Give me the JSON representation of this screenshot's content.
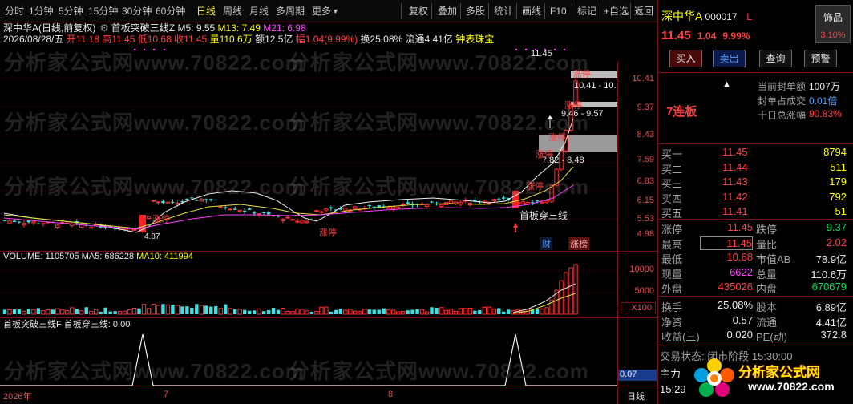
{
  "toolbar": {
    "periods": [
      "分时",
      "1分钟",
      "5分钟",
      "15分钟",
      "30分钟",
      "60分钟",
      "日线",
      "周线",
      "月线",
      "多周期",
      "更多"
    ],
    "active": "日线",
    "tools": [
      "复权",
      "叠加",
      "多股",
      "统计",
      "画线",
      "F10",
      "标记",
      "+自选",
      "返回"
    ],
    "chevron_label": "▼"
  },
  "chart": {
    "stock_header": "深中华A(日线,前复权)",
    "indicator_name": "首板突破三线Z",
    "ma5": "M5: 9.55",
    "ma13": "M13: 7.49",
    "ma21": "M21: 6.98",
    "date_line": "2026/08/28/五",
    "open": "开11.18",
    "high": "高11.45",
    "low": "低10.68",
    "close": "收11.45",
    "volume": "量110.6万",
    "amount": "额12.5亿",
    "change": "幅1.04(9.99%)",
    "turnover": "换25.08%",
    "float": "流通4.41亿",
    "zhongbiao": "钟表珠宝",
    "price_axis": [
      "11.45",
      "10.41",
      "9.37",
      "8.43",
      "7.59",
      "6.83",
      "6.15",
      "5.53",
      "4.98"
    ],
    "annotations": {
      "top_price": "11.45",
      "range1": "10.41 - 10.",
      "range2": "9.46 - 9.57",
      "range3": "7.82 - 8.48",
      "low_price": "4.87",
      "signal": "首板穿三线",
      "zt": "涨停",
      "cai": "财",
      "ztbang": "涨榜"
    },
    "volume_header": {
      "label": "VOLUME: 1105705",
      "ma5": "MA5: 686228",
      "ma10": "MA10: 411994"
    },
    "volume_axis": [
      "10000",
      "5000",
      "X100"
    ],
    "indicator_header": {
      "label": "首板突破三线F",
      "value": "首板穿三线: 0.00"
    },
    "indicator_value": "0.07",
    "x_axis": [
      "2026年",
      "7",
      "8"
    ],
    "period_tag": "日线"
  },
  "quote": {
    "name": "深中华A",
    "code": "000017",
    "flag": "L",
    "sector": "饰品",
    "sector_pct": "3.10%",
    "price": "11.45",
    "change": "1.04",
    "pct": "9.99%",
    "buttons": [
      "买入",
      "卖出",
      "查询",
      "预警"
    ],
    "lianban": "7连板",
    "seal_rows": [
      {
        "label": "当前封单额",
        "value": "1007万"
      },
      {
        "label": "封单占成交",
        "value": "0.01倍"
      },
      {
        "label": "十日总涨幅",
        "value": "90.83%"
      }
    ],
    "bids": [
      {
        "label": "买一",
        "price": "11.45",
        "vol": "8794"
      },
      {
        "label": "买二",
        "price": "11.44",
        "vol": "511"
      },
      {
        "label": "买三",
        "price": "11.43",
        "vol": "179"
      },
      {
        "label": "买四",
        "price": "11.42",
        "vol": "792"
      },
      {
        "label": "买五",
        "price": "11.41",
        "vol": "51"
      }
    ],
    "stats": [
      {
        "l1": "涨停",
        "v1": "11.45",
        "l2": "跌停",
        "v2": "9.37"
      },
      {
        "l1": "最高",
        "v1": "11.45",
        "l2": "量比",
        "v2": "2.02"
      },
      {
        "l1": "最低",
        "v1": "10.68",
        "l2": "市值AB",
        "v2": "78.9亿"
      },
      {
        "l1": "现量",
        "v1": "6622",
        "l2": "总量",
        "v2": "110.6万"
      },
      {
        "l1": "外盘",
        "v1": "435026",
        "l2": "内盘",
        "v2": "670679"
      }
    ],
    "fin": [
      {
        "l1": "换手",
        "v1": "25.08%",
        "l2": "股本",
        "v2": "6.89亿"
      },
      {
        "l1": "净资",
        "v1": "0.57",
        "l2": "流通",
        "v2": "4.41亿"
      },
      {
        "l1": "收益(三)",
        "v1": "0.020",
        "l2": "PE(动)",
        "v2": "372.8"
      }
    ],
    "trade_status": "交易状态: 闭市阶段 15:30:00",
    "zhuli": "主力",
    "time": "15:29"
  },
  "watermark": {
    "text1": "分析家公式网www.70822.com",
    "logo_text": "分析家公式网",
    "logo_url": "www.70822.com"
  }
}
